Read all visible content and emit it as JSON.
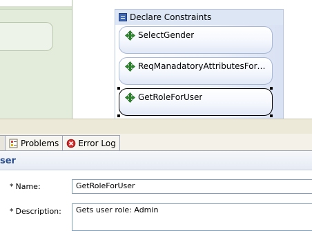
{
  "diagram": {
    "container_title": "Declare Constraints",
    "nodes": [
      {
        "label": "SelectGender",
        "icon": "constraint-icon"
      },
      {
        "label": "ReqManadatoryAttributesForCust...",
        "icon": "constraint-icon"
      },
      {
        "label": "GetRoleForUser",
        "icon": "constraint-icon",
        "selected": true
      }
    ]
  },
  "tabs": [
    {
      "label": "Problems",
      "icon": "problems-icon"
    },
    {
      "label": "Error Log",
      "icon": "error-log-icon"
    }
  ],
  "properties": {
    "title": "ser",
    "fields": [
      {
        "required_mark": "*",
        "label": "Name:",
        "value": "GetRoleForUser"
      },
      {
        "required_mark": "*",
        "label": "Description:",
        "value": "Gets user role: Admin"
      }
    ]
  },
  "colors": {
    "accent": "#2a4c8a",
    "constraint_icon": "#2e8b2e",
    "container_bg": "#dde6f5",
    "left_lane_bg": "#d9e4cf"
  }
}
